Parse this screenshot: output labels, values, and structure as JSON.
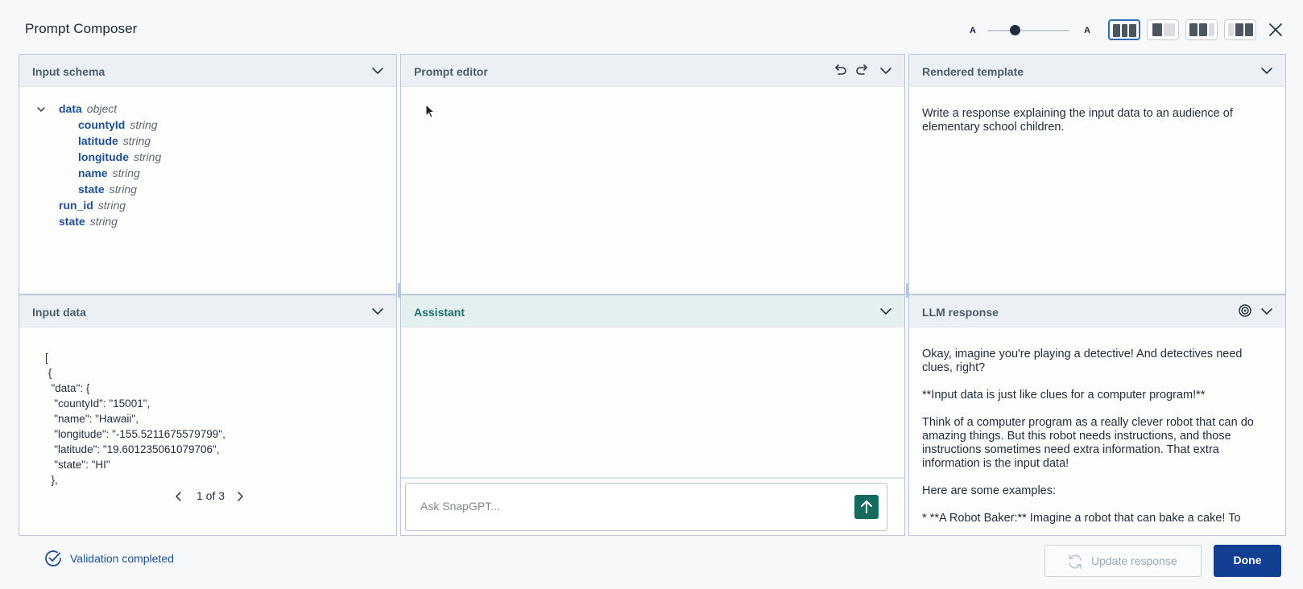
{
  "window": {
    "title": "Prompt Composer"
  },
  "toolbar": {
    "font_small_label": "A",
    "font_large_label": "A",
    "font_size_level": 0.33
  },
  "panels": {
    "input_schema": {
      "title": "Input schema",
      "tree": [
        {
          "key": "data",
          "type": "object",
          "level": 0,
          "expanded": true
        },
        {
          "key": "countyId",
          "type": "string",
          "level": 1
        },
        {
          "key": "latitude",
          "type": "string",
          "level": 1
        },
        {
          "key": "longitude",
          "type": "string",
          "level": 1
        },
        {
          "key": "name",
          "type": "string",
          "level": 1
        },
        {
          "key": "state",
          "type": "string",
          "level": 1
        },
        {
          "key": "run_id",
          "type": "string",
          "level": 0
        },
        {
          "key": "state",
          "type": "string",
          "level": 0
        }
      ]
    },
    "prompt_editor": {
      "title": "Prompt editor",
      "content": ""
    },
    "rendered_template": {
      "title": "Rendered template",
      "text": "Write a response explaining the input data to an audience of elementary school children."
    },
    "input_data": {
      "title": "Input data",
      "json_text": "[\n {\n  \"data\": {\n   \"countyId\": \"15001\",\n   \"name\": \"Hawaii\",\n   \"longitude\": \"-155.5211675579799\",\n   \"latitude\": \"19.601235061079706\",\n   \"state\": \"HI\"\n  },",
      "pager_text": "1 of 3"
    },
    "assistant": {
      "title": "Assistant",
      "input_placeholder": "Ask SnapGPT..."
    },
    "llm_response": {
      "title": "LLM response",
      "paragraphs": [
        "Okay, imagine you're playing a detective! And detectives need clues, right?",
        "**Input data is just like clues for a computer program!**",
        "Think of a computer program as a really clever robot that can do amazing things. But this robot needs instructions, and those instructions sometimes need extra information. That extra information is the input data!",
        "Here are some examples:",
        "*   **A Robot Baker:** Imagine a robot that can bake a cake! To"
      ]
    }
  },
  "footer": {
    "status_text": "Validation completed",
    "update_label": "Update response",
    "done_label": "Done"
  },
  "colors": {
    "accent": "#123f91",
    "teal": "#146a5e",
    "panel_border": "#b7c8dc",
    "schema_key": "#1d4f91"
  }
}
